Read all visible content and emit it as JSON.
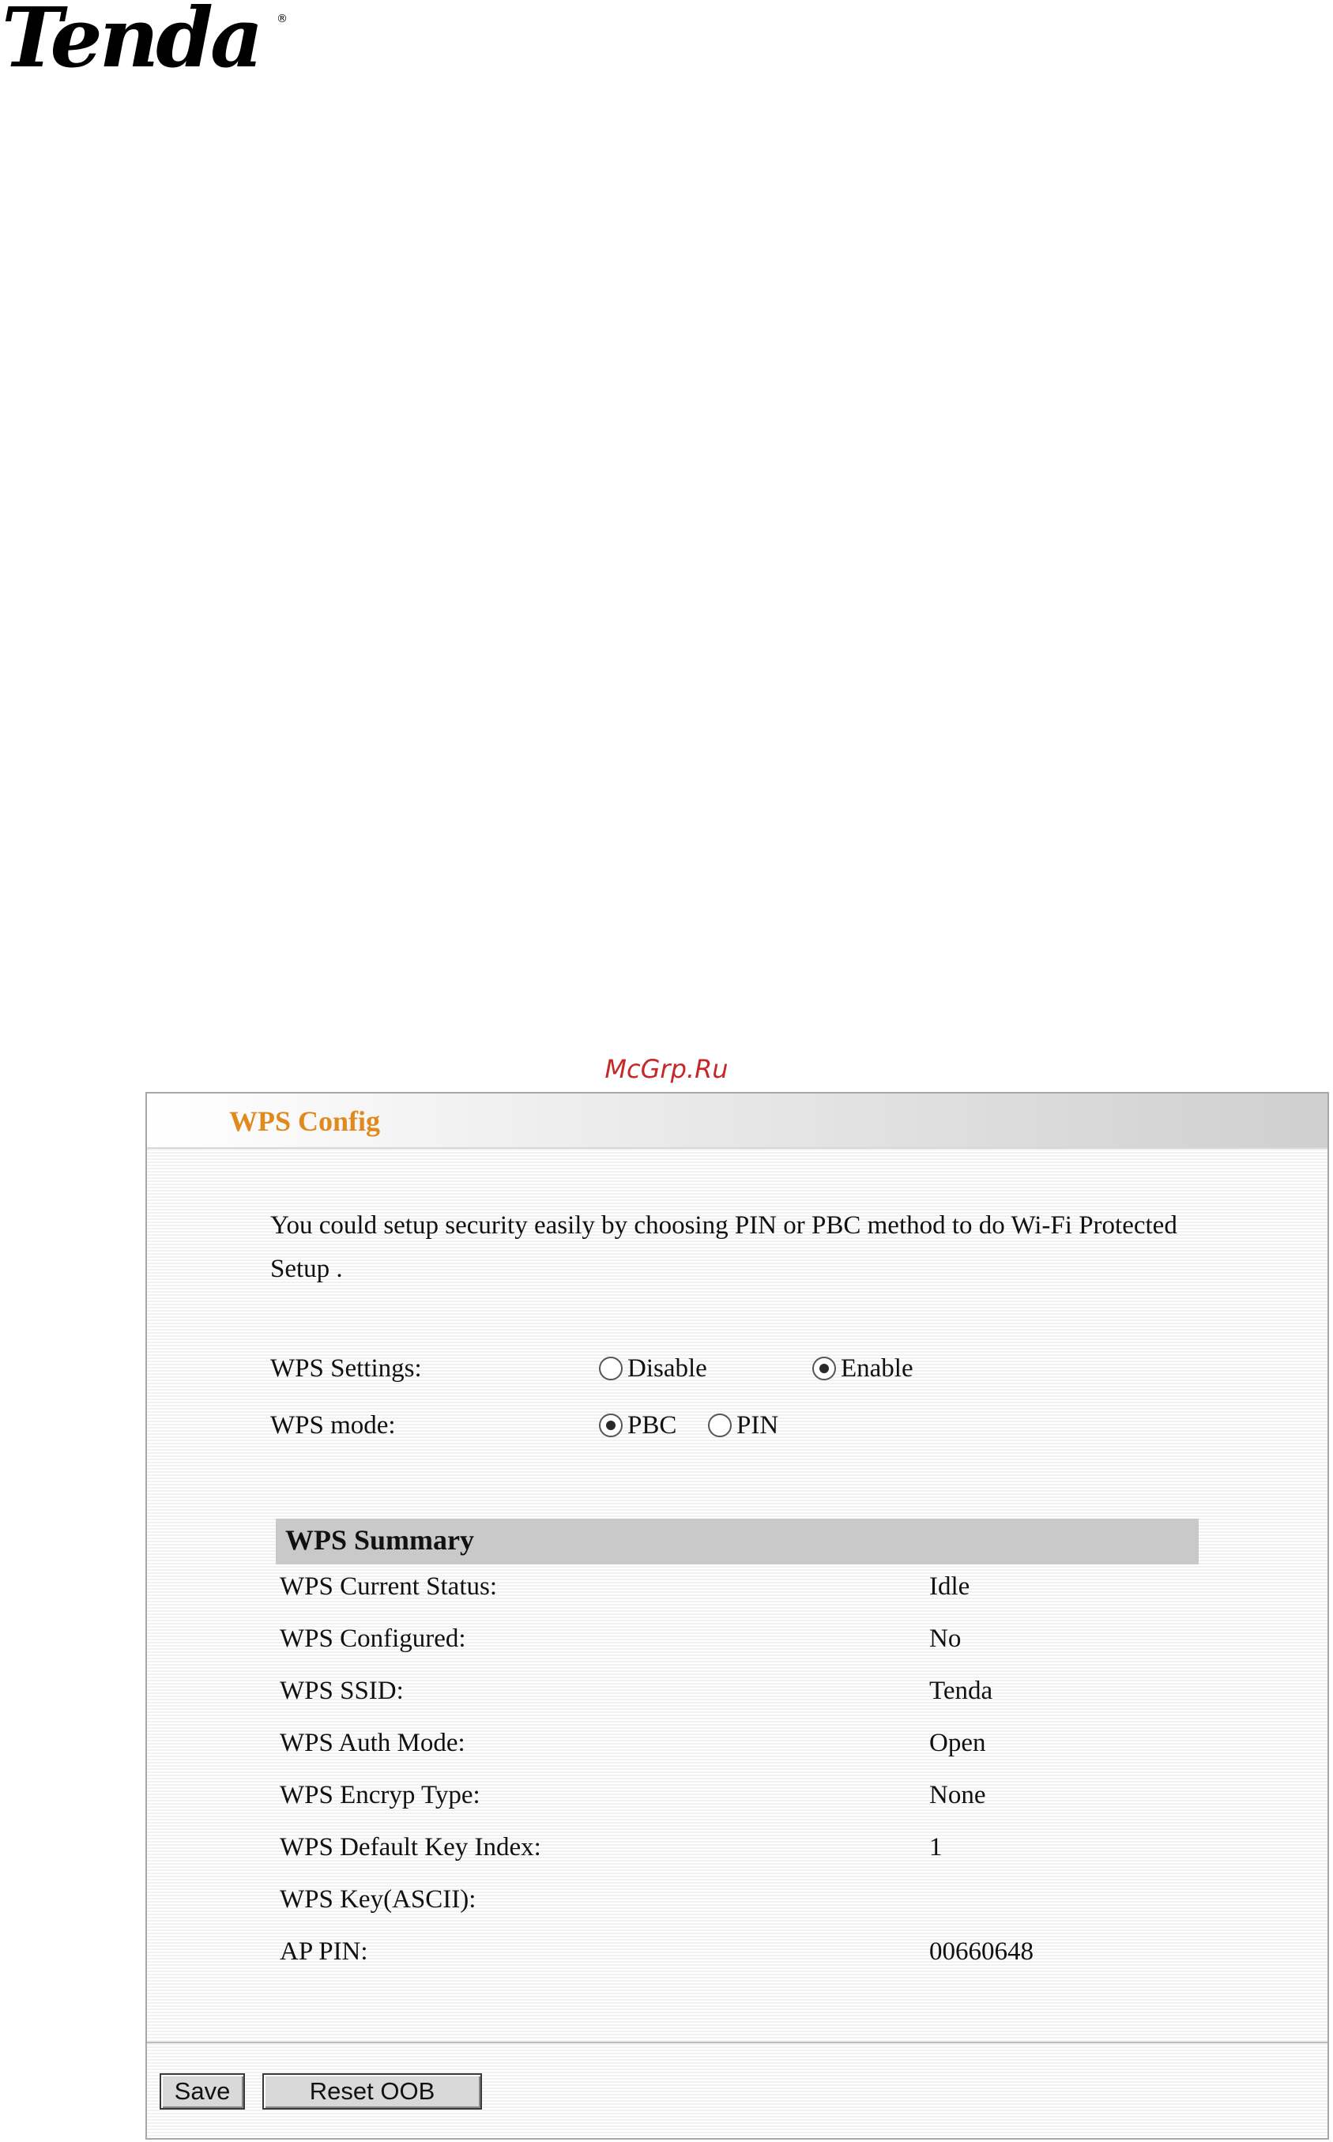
{
  "brand": {
    "logo_text": "Tenda",
    "registered_mark": "®"
  },
  "watermark": "McGrp.Ru",
  "panel": {
    "title": "WPS Config",
    "intro": "You could setup security easily by choosing PIN or PBC method to do Wi-Fi Protected Setup .",
    "wps_settings": {
      "label": "WPS Settings:",
      "options": [
        "Disable",
        "Enable"
      ],
      "selected": "Enable"
    },
    "wps_mode": {
      "label": "WPS mode:",
      "options": [
        "PBC",
        "PIN"
      ],
      "selected": "PBC"
    },
    "summary": {
      "title": "WPS Summary",
      "rows": [
        {
          "label": "WPS Current Status:",
          "value": "Idle"
        },
        {
          "label": "WPS Configured:",
          "value": "No"
        },
        {
          "label": "WPS SSID:",
          "value": "Tenda"
        },
        {
          "label": "WPS Auth Mode:",
          "value": "Open"
        },
        {
          "label": "WPS Encryp Type:",
          "value": "None"
        },
        {
          "label": "WPS Default Key Index:",
          "value": "1"
        },
        {
          "label": "WPS Key(ASCII):",
          "value": ""
        },
        {
          "label": "AP PIN:",
          "value": "00660648"
        }
      ]
    },
    "buttons": {
      "save": "Save",
      "reset": "Reset OOB"
    }
  }
}
